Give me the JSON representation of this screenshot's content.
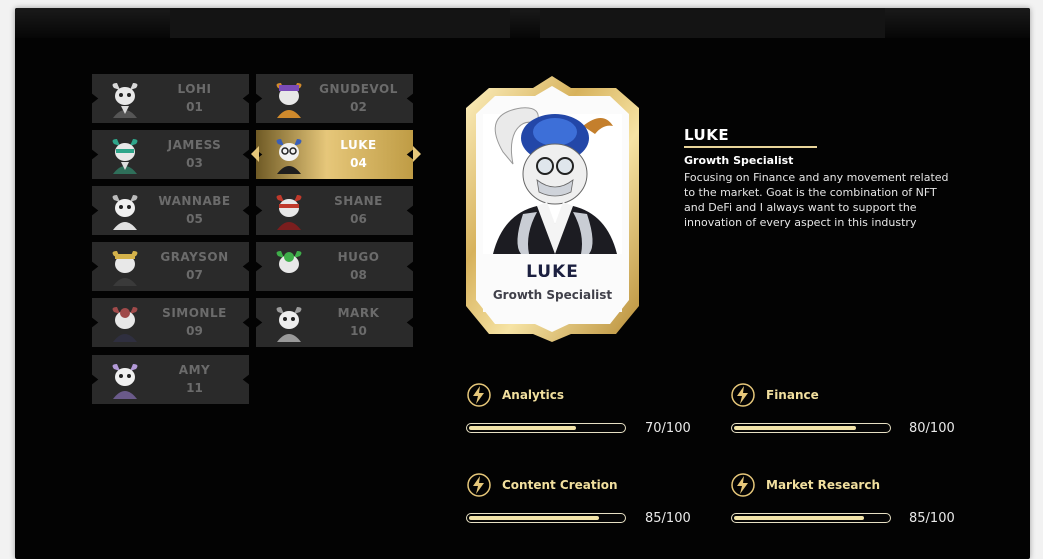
{
  "team": [
    {
      "name": "LOHI",
      "number": "01",
      "accent": "#d9d9d9"
    },
    {
      "name": "GNUDEVOL",
      "number": "02",
      "accent": "#d08a2c"
    },
    {
      "name": "JAMESS",
      "number": "03",
      "accent": "#2fa58a"
    },
    {
      "name": "LUKE",
      "number": "04",
      "accent": "#3a5fb8",
      "active": true
    },
    {
      "name": "WANNABE",
      "number": "05",
      "accent": "#cfcfcf"
    },
    {
      "name": "SHANE",
      "number": "06",
      "accent": "#c0392b"
    },
    {
      "name": "GRAYSON",
      "number": "07",
      "accent": "#d4b24a"
    },
    {
      "name": "HUGO",
      "number": "08",
      "accent": "#3fae4a"
    },
    {
      "name": "SIMONLE",
      "number": "09",
      "accent": "#a04a4a"
    },
    {
      "name": "MARK",
      "number": "10",
      "accent": "#9a9a9a"
    },
    {
      "name": "AMY",
      "number": "11",
      "accent": "#b39ad8"
    }
  ],
  "featured": {
    "name": "LUKE",
    "role": "Growth Specialist",
    "card_name": "LUKE",
    "card_role": "Growth Specialist",
    "description": "Focusing on Finance and any movement related to the market. Goat is the combination of NFT and DeFi and I always want to support the innovation of every aspect in this industry"
  },
  "skills": [
    {
      "label": "Analytics",
      "value": "70/100",
      "level": 0.7
    },
    {
      "label": "Finance",
      "value": "80/100",
      "level": 0.8
    },
    {
      "label": "Content Creation",
      "value": "85/100",
      "level": 0.85
    },
    {
      "label": "Market Research",
      "value": "85/100",
      "level": 0.85
    }
  ],
  "colors": {
    "gold": "#e6c77a",
    "card_bg": "#2a2a2a",
    "skill_label": "#f1df9e",
    "background": "#030303"
  },
  "icons": {
    "skill": "lightning-bolt-icon"
  }
}
